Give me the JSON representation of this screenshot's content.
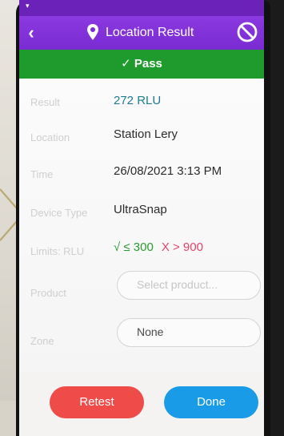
{
  "header": {
    "title": "Location Result",
    "back_icon": "chevron-left-icon",
    "action_icon": "no-scan-icon"
  },
  "status": {
    "text": "✓ Pass",
    "color": "#1f9a2c"
  },
  "rows": [
    {
      "label": "Result",
      "value": "272 RLU"
    },
    {
      "label": "Location",
      "value": "Station Lery"
    },
    {
      "label": "Time",
      "value": "26/08/2021 3:13 PM"
    },
    {
      "label": "Device Type",
      "value": "UltraSnap"
    }
  ],
  "limits": {
    "label": "Limits: RLU",
    "pass": "√ ≤ 300",
    "fail": "X > 900"
  },
  "product": {
    "label": "Product",
    "placeholder": "Select product..."
  },
  "zone": {
    "label": "Zone",
    "value": "None"
  },
  "buttons": {
    "retest": "Retest",
    "done": "Done"
  }
}
